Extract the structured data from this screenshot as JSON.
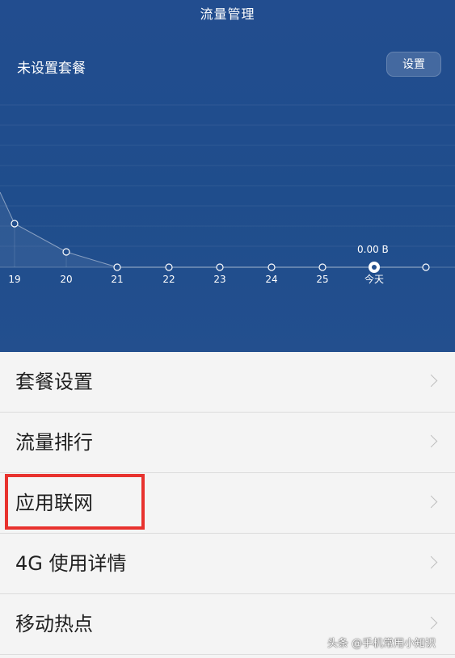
{
  "header": {
    "title": "流量管理",
    "plan_status": "未设置套餐",
    "settings_button": "设置"
  },
  "chart_data": {
    "type": "line",
    "categories": [
      "19",
      "20",
      "21",
      "22",
      "23",
      "24",
      "25",
      "今天",
      ""
    ],
    "values": [
      null,
      null,
      0,
      0,
      0,
      0,
      0,
      0,
      null
    ],
    "today_label": "0.00 B"
  },
  "menu": {
    "items": [
      {
        "label": "套餐设置"
      },
      {
        "label": "流量排行"
      },
      {
        "label": "应用联网"
      },
      {
        "label": "4G 使用详情"
      },
      {
        "label": "移动热点"
      }
    ]
  },
  "watermark": "头条 @手机常用小知识"
}
